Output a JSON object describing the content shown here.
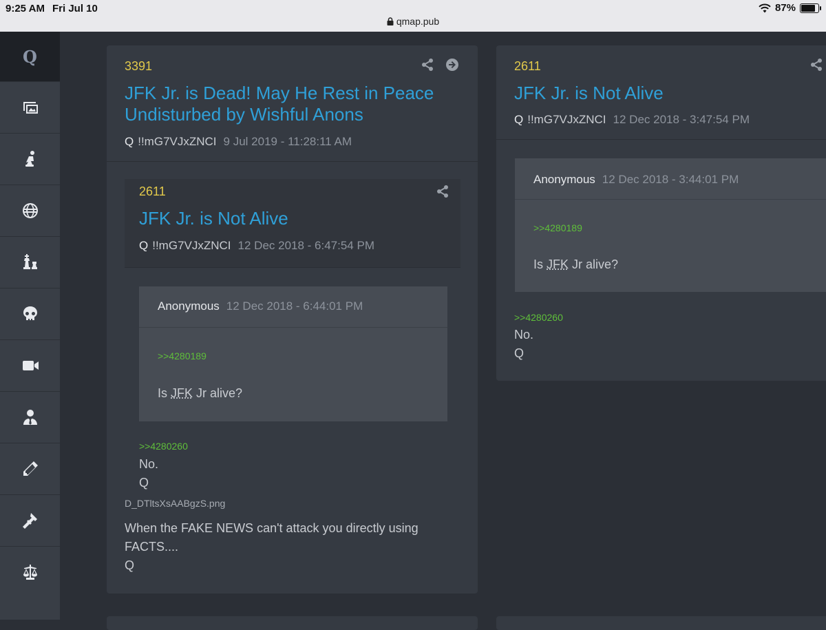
{
  "status_bar": {
    "time": "9:25 AM",
    "date": "Fri Jul 10",
    "url": "qmap.pub",
    "battery": "87%"
  },
  "sidebar": {
    "logo": "Q",
    "items": [
      {
        "icon": "images-icon"
      },
      {
        "icon": "kneeling-person-icon"
      },
      {
        "icon": "globe-icon"
      },
      {
        "icon": "chess-icon"
      },
      {
        "icon": "skull-icon"
      },
      {
        "icon": "video-camera-icon"
      },
      {
        "icon": "user-tie-icon"
      },
      {
        "icon": "pencil-icon"
      },
      {
        "icon": "gavel-icon"
      },
      {
        "icon": "balance-scale-icon"
      }
    ]
  },
  "left_post": {
    "number": "3391",
    "title_line1": "JFK Jr. is Dead! May He Rest in Peace",
    "title_line2": "Undisturbed by Wishful Anons",
    "author": "Q",
    "tripcode": "!!mG7VJxZNCI",
    "timestamp": "9 Jul 2019 - 11:28:11 AM",
    "quoted": {
      "number": "2611",
      "title": "JFK Jr. is Not Alive",
      "author": "Q",
      "tripcode": "!!mG7VJxZNCI",
      "timestamp": "12 Dec 2018 - 6:47:54 PM",
      "anon": {
        "name": "Anonymous",
        "timestamp": "12 Dec 2018 - 6:44:01 PM",
        "ref": ">>4280189",
        "text_pre": "Is ",
        "text_jfk": "JFK",
        "text_post": " Jr alive?"
      },
      "reply_ref": ">>4280260",
      "reply_line1": "No.",
      "reply_line2": "Q"
    },
    "filename": "D_DTltsXsAABgzS.png",
    "body_line1": "When the FAKE NEWS can't attack you directly using",
    "body_line2": "FACTS....",
    "body_line3": "Q"
  },
  "right_post": {
    "number": "2611",
    "title": "JFK Jr. is Not Alive",
    "author": "Q",
    "tripcode": "!!mG7VJxZNCI",
    "timestamp": "12 Dec 2018 - 3:47:54 PM",
    "anon": {
      "name": "Anonymous",
      "timestamp": "12 Dec 2018 - 3:44:01 PM",
      "ref": ">>4280189",
      "text_pre": "Is ",
      "text_jfk": "JFK",
      "text_post": " Jr alive?"
    },
    "reply_ref": ">>4280260",
    "reply_line1": "No.",
    "reply_line2": "Q"
  }
}
